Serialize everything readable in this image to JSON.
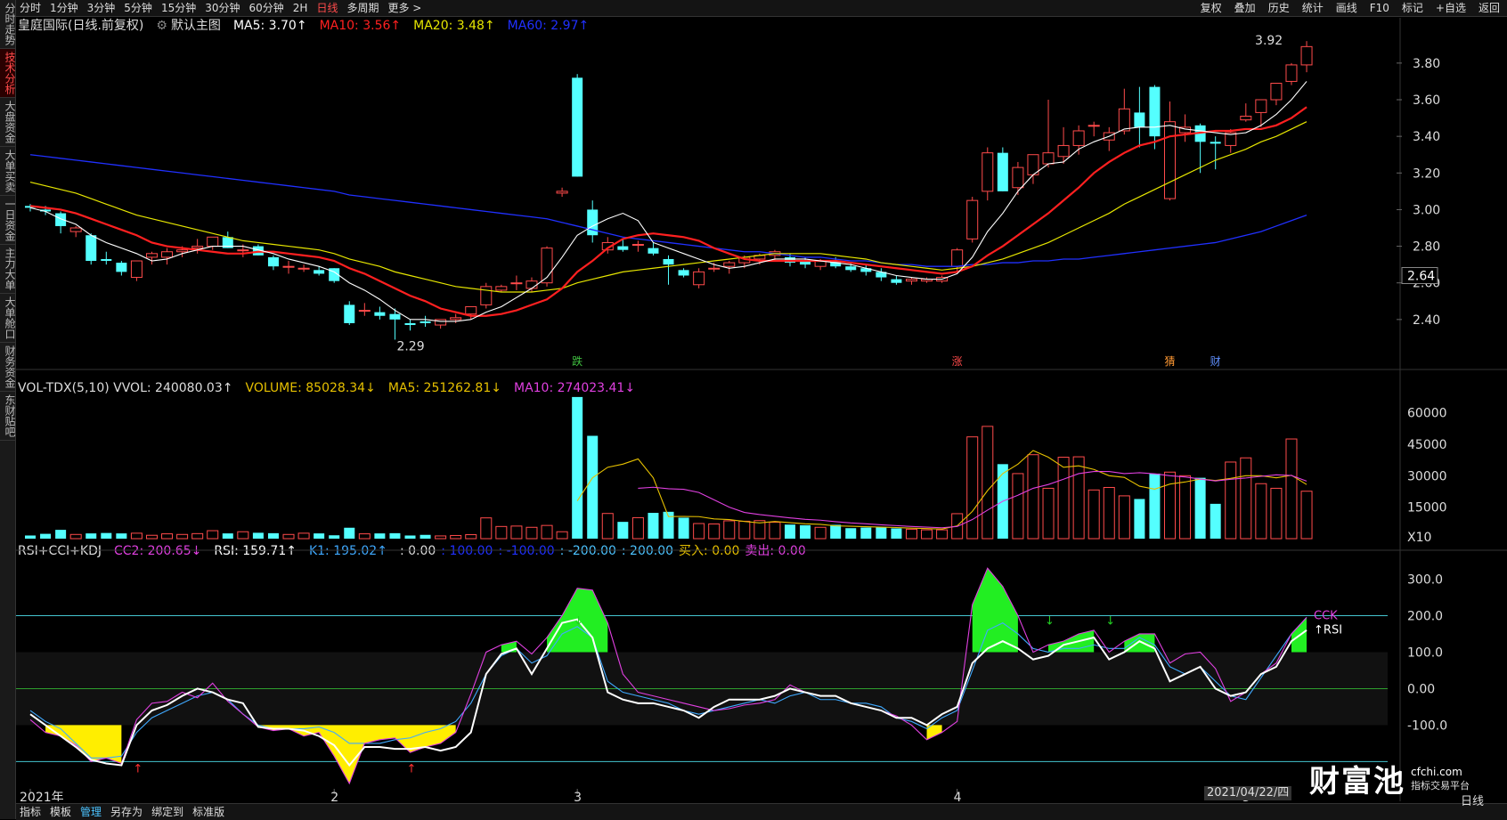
{
  "left_rail": [
    "分时走势",
    "技术分析",
    "大盘资金",
    "大单买卖",
    "一日资金",
    "主力大单",
    "大单舱口",
    "财务资金",
    "东财贴吧"
  ],
  "left_rail_active": 1,
  "period_tabs": [
    "分时",
    "1分钟",
    "3分钟",
    "5分钟",
    "15分钟",
    "30分钟",
    "60分钟",
    "2H",
    "日线",
    "多周期",
    "更多 >"
  ],
  "period_active": 8,
  "right_tools": [
    "复权",
    "叠加",
    "历史",
    "统计",
    "画线",
    "F10",
    "标记",
    "+自选",
    "返回"
  ],
  "legend_main": {
    "title": "皇庭国际(日线.前复权)",
    "default_label": "默认主图",
    "ma5": "MA5: 3.70↑",
    "ma10": "MA10: 3.56↑",
    "ma20": "MA20: 3.48↑",
    "ma60": "MA60: 2.97↑"
  },
  "legend_vol": {
    "vol": "VOL-TDX(5,10) VVOL: 240080.03↑",
    "volume": "VOLUME: 85028.34↓",
    "ma5": "MA5: 251262.81↓",
    "ma10": "MA10: 274023.41↓"
  },
  "legend_ind": {
    "name": "RSI+CCI+KDJ",
    "cc2": "CC2: 200.65↓",
    "rsi": "RSI: 159.71↑",
    "k1": "K1: 195.02↑",
    "z1": ": 0.00",
    "z2": ": 100.00",
    "z3": ": -100.00",
    "z4": ": -200.00",
    "z5": ": 200.00",
    "buy": "买入: 0.00",
    "sell": "卖出: 0.00"
  },
  "price_axis": [
    "3.80",
    "3.60",
    "3.40",
    "3.20",
    "3.00",
    "2.80",
    "2.60",
    "2.40"
  ],
  "price_current": "2.64",
  "high_label": "3.92",
  "low_label": "2.29",
  "vol_axis": [
    "60000",
    "45000",
    "30000",
    "15000",
    "X10"
  ],
  "ind_axis": [
    "300.0",
    "200.0",
    "100.0",
    "0.00",
    "-100.0"
  ],
  "ind_end_labels": [
    "CCK",
    "↑RSI"
  ],
  "date_axis": [
    "2021年",
    "2",
    "3",
    "4",
    "5"
  ],
  "date_box": "2021/04/22/四",
  "candle_marks": [
    {
      "i": 36,
      "text": "跌",
      "color": "#40c040"
    },
    {
      "i": 61,
      "text": "涨",
      "color": "#ff4b4b"
    },
    {
      "i": 75,
      "text": "猜",
      "color": "#ff9933"
    },
    {
      "i": 78,
      "text": "财",
      "color": "#6090ff"
    }
  ],
  "bottom_tabs": [
    "指标",
    "模板",
    "管理",
    "另存为",
    "绑定到",
    "标准版"
  ],
  "bottom_active": 2,
  "period_label": "日线",
  "watermark": {
    "big": "财富池",
    "site": "cfchi.com",
    "sub": "指标交易平台"
  },
  "colors": {
    "up": "#ff4b4b",
    "down": "#54ffff",
    "ma5": "#ffffff",
    "ma10": "#ff2020",
    "ma20": "#e6e600",
    "ma60": "#2030ff"
  },
  "chart_data": {
    "type": "candlestick",
    "ylim": [
      2.2,
      3.95
    ],
    "candles": [
      [
        3.02,
        3.03,
        2.99,
        3.01
      ],
      [
        3.0,
        3.02,
        2.97,
        2.99
      ],
      [
        2.98,
        2.99,
        2.87,
        2.91
      ],
      [
        2.88,
        2.91,
        2.85,
        2.9
      ],
      [
        2.86,
        2.87,
        2.7,
        2.72
      ],
      [
        2.73,
        2.77,
        2.7,
        2.72
      ],
      [
        2.71,
        2.72,
        2.64,
        2.66
      ],
      [
        2.63,
        2.72,
        2.61,
        2.72
      ],
      [
        2.74,
        2.77,
        2.7,
        2.76
      ],
      [
        2.74,
        2.79,
        2.7,
        2.77
      ],
      [
        2.77,
        2.8,
        2.74,
        2.78
      ],
      [
        2.79,
        2.84,
        2.76,
        2.8
      ],
      [
        2.8,
        2.85,
        2.78,
        2.85
      ],
      [
        2.85,
        2.88,
        2.79,
        2.79
      ],
      [
        2.78,
        2.81,
        2.74,
        2.78
      ],
      [
        2.8,
        2.81,
        2.75,
        2.75
      ],
      [
        2.74,
        2.75,
        2.67,
        2.69
      ],
      [
        2.69,
        2.72,
        2.65,
        2.69
      ],
      [
        2.68,
        2.7,
        2.66,
        2.68
      ],
      [
        2.67,
        2.69,
        2.64,
        2.65
      ],
      [
        2.68,
        2.68,
        2.6,
        2.61
      ],
      [
        2.48,
        2.5,
        2.37,
        2.38
      ],
      [
        2.45,
        2.49,
        2.42,
        2.45
      ],
      [
        2.44,
        2.47,
        2.4,
        2.42
      ],
      [
        2.43,
        2.46,
        2.29,
        2.4
      ],
      [
        2.38,
        2.4,
        2.34,
        2.37
      ],
      [
        2.39,
        2.42,
        2.36,
        2.38
      ],
      [
        2.37,
        2.4,
        2.35,
        2.4
      ],
      [
        2.4,
        2.43,
        2.38,
        2.41
      ],
      [
        2.43,
        2.47,
        2.4,
        2.47
      ],
      [
        2.48,
        2.6,
        2.46,
        2.58
      ],
      [
        2.56,
        2.59,
        2.55,
        2.58
      ],
      [
        2.6,
        2.64,
        2.56,
        2.6
      ],
      [
        2.57,
        2.63,
        2.55,
        2.61
      ],
      [
        2.6,
        2.8,
        2.58,
        2.79
      ],
      [
        3.09,
        3.12,
        3.07,
        3.1
      ],
      [
        3.72,
        3.74,
        3.18,
        3.18
      ],
      [
        3.0,
        3.05,
        2.82,
        2.86
      ],
      [
        2.78,
        2.85,
        2.76,
        2.82
      ],
      [
        2.8,
        2.84,
        2.77,
        2.78
      ],
      [
        2.81,
        2.83,
        2.77,
        2.81
      ],
      [
        2.79,
        2.82,
        2.75,
        2.76
      ],
      [
        2.73,
        2.75,
        2.59,
        2.7
      ],
      [
        2.67,
        2.68,
        2.63,
        2.64
      ],
      [
        2.59,
        2.68,
        2.57,
        2.66
      ],
      [
        2.68,
        2.71,
        2.66,
        2.68
      ],
      [
        2.69,
        2.72,
        2.65,
        2.71
      ],
      [
        2.71,
        2.75,
        2.68,
        2.74
      ],
      [
        2.73,
        2.76,
        2.7,
        2.75
      ],
      [
        2.75,
        2.78,
        2.72,
        2.77
      ],
      [
        2.74,
        2.76,
        2.69,
        2.71
      ],
      [
        2.72,
        2.74,
        2.68,
        2.7
      ],
      [
        2.69,
        2.73,
        2.67,
        2.72
      ],
      [
        2.72,
        2.74,
        2.68,
        2.69
      ],
      [
        2.69,
        2.71,
        2.66,
        2.67
      ],
      [
        2.68,
        2.7,
        2.64,
        2.66
      ],
      [
        2.66,
        2.68,
        2.61,
        2.63
      ],
      [
        2.62,
        2.64,
        2.59,
        2.6
      ],
      [
        2.61,
        2.63,
        2.59,
        2.62
      ],
      [
        2.61,
        2.63,
        2.6,
        2.62
      ],
      [
        2.61,
        2.64,
        2.6,
        2.63
      ],
      [
        2.69,
        2.79,
        2.66,
        2.78
      ],
      [
        2.84,
        3.07,
        2.82,
        3.05
      ],
      [
        3.1,
        3.34,
        3.05,
        3.31
      ],
      [
        3.31,
        3.34,
        3.1,
        3.1
      ],
      [
        3.12,
        3.26,
        3.08,
        3.23
      ],
      [
        3.19,
        3.3,
        3.14,
        3.3
      ],
      [
        3.25,
        3.6,
        3.23,
        3.31
      ],
      [
        3.29,
        3.45,
        3.25,
        3.35
      ],
      [
        3.35,
        3.46,
        3.3,
        3.43
      ],
      [
        3.46,
        3.48,
        3.4,
        3.46
      ],
      [
        3.38,
        3.45,
        3.32,
        3.42
      ],
      [
        3.43,
        3.66,
        3.41,
        3.55
      ],
      [
        3.53,
        3.67,
        3.34,
        3.45
      ],
      [
        3.67,
        3.68,
        3.33,
        3.4
      ],
      [
        3.06,
        3.59,
        3.05,
        3.48
      ],
      [
        3.42,
        3.52,
        3.37,
        3.45
      ],
      [
        3.46,
        3.47,
        3.2,
        3.37
      ],
      [
        3.37,
        3.4,
        3.22,
        3.36
      ],
      [
        3.35,
        3.44,
        3.31,
        3.42
      ],
      [
        3.49,
        3.58,
        3.48,
        3.51
      ],
      [
        3.53,
        3.6,
        3.45,
        3.6
      ],
      [
        3.6,
        3.69,
        3.57,
        3.69
      ],
      [
        3.7,
        3.8,
        3.68,
        3.79
      ],
      [
        3.79,
        3.92,
        3.75,
        3.89
      ]
    ],
    "ma5": [
      3.01,
      2.99,
      2.95,
      2.92,
      2.86,
      2.82,
      2.79,
      2.76,
      2.72,
      2.73,
      2.76,
      2.78,
      2.8,
      2.8,
      2.8,
      2.78,
      2.76,
      2.73,
      2.71,
      2.69,
      2.66,
      2.6,
      2.56,
      2.51,
      2.45,
      2.4,
      2.4,
      2.39,
      2.39,
      2.4,
      2.44,
      2.47,
      2.52,
      2.57,
      2.63,
      2.74,
      2.86,
      2.91,
      2.95,
      2.98,
      2.94,
      2.82,
      2.79,
      2.76,
      2.73,
      2.7,
      2.68,
      2.69,
      2.71,
      2.73,
      2.73,
      2.73,
      2.72,
      2.71,
      2.7,
      2.68,
      2.66,
      2.64,
      2.63,
      2.62,
      2.62,
      2.65,
      2.74,
      2.88,
      2.98,
      3.1,
      3.19,
      3.25,
      3.26,
      3.33,
      3.37,
      3.4,
      3.44,
      3.45,
      3.45,
      3.46,
      3.44,
      3.43,
      3.42,
      3.41,
      3.42,
      3.46,
      3.52,
      3.6,
      3.7
    ],
    "ma10": [
      3.02,
      3.01,
      3.0,
      2.98,
      2.95,
      2.92,
      2.89,
      2.86,
      2.82,
      2.8,
      2.79,
      2.78,
      2.77,
      2.76,
      2.76,
      2.77,
      2.77,
      2.76,
      2.75,
      2.74,
      2.72,
      2.68,
      2.65,
      2.61,
      2.57,
      2.53,
      2.5,
      2.46,
      2.44,
      2.42,
      2.42,
      2.43,
      2.45,
      2.48,
      2.51,
      2.57,
      2.66,
      2.72,
      2.79,
      2.84,
      2.86,
      2.87,
      2.86,
      2.85,
      2.83,
      2.79,
      2.76,
      2.73,
      2.72,
      2.72,
      2.72,
      2.72,
      2.72,
      2.72,
      2.71,
      2.7,
      2.69,
      2.68,
      2.67,
      2.66,
      2.65,
      2.66,
      2.69,
      2.75,
      2.8,
      2.86,
      2.92,
      2.98,
      3.05,
      3.12,
      3.2,
      3.26,
      3.31,
      3.35,
      3.37,
      3.4,
      3.41,
      3.42,
      3.43,
      3.43,
      3.44,
      3.44,
      3.46,
      3.5,
      3.56
    ],
    "ma20": [
      3.15,
      3.13,
      3.11,
      3.09,
      3.06,
      3.03,
      3.0,
      2.97,
      2.95,
      2.93,
      2.91,
      2.89,
      2.87,
      2.85,
      2.83,
      2.82,
      2.81,
      2.8,
      2.79,
      2.78,
      2.76,
      2.73,
      2.71,
      2.69,
      2.66,
      2.64,
      2.62,
      2.6,
      2.58,
      2.57,
      2.56,
      2.55,
      2.55,
      2.55,
      2.56,
      2.57,
      2.6,
      2.62,
      2.64,
      2.66,
      2.67,
      2.68,
      2.69,
      2.7,
      2.71,
      2.72,
      2.73,
      2.74,
      2.75,
      2.76,
      2.76,
      2.76,
      2.76,
      2.75,
      2.74,
      2.73,
      2.71,
      2.7,
      2.69,
      2.68,
      2.67,
      2.68,
      2.69,
      2.71,
      2.73,
      2.76,
      2.79,
      2.82,
      2.86,
      2.9,
      2.94,
      2.98,
      3.03,
      3.07,
      3.11,
      3.15,
      3.19,
      3.23,
      3.27,
      3.3,
      3.33,
      3.37,
      3.4,
      3.44,
      3.48
    ],
    "ma60": [
      3.3,
      3.29,
      3.28,
      3.27,
      3.26,
      3.25,
      3.24,
      3.23,
      3.22,
      3.21,
      3.2,
      3.19,
      3.18,
      3.17,
      3.16,
      3.15,
      3.14,
      3.13,
      3.12,
      3.11,
      3.1,
      3.08,
      3.07,
      3.06,
      3.05,
      3.04,
      3.03,
      3.02,
      3.01,
      3.0,
      2.99,
      2.98,
      2.97,
      2.96,
      2.95,
      2.93,
      2.91,
      2.89,
      2.87,
      2.85,
      2.84,
      2.83,
      2.82,
      2.81,
      2.8,
      2.79,
      2.78,
      2.77,
      2.77,
      2.76,
      2.75,
      2.74,
      2.74,
      2.73,
      2.72,
      2.72,
      2.71,
      2.7,
      2.7,
      2.69,
      2.69,
      2.69,
      2.7,
      2.7,
      2.71,
      2.71,
      2.72,
      2.72,
      2.73,
      2.73,
      2.74,
      2.75,
      2.76,
      2.77,
      2.78,
      2.79,
      2.8,
      2.81,
      2.82,
      2.84,
      2.86,
      2.88,
      2.91,
      2.94,
      2.97
    ],
    "volume": [
      1500,
      2300,
      4200,
      2000,
      2500,
      2700,
      2500,
      2600,
      1600,
      2300,
      2000,
      2400,
      3800,
      2500,
      3300,
      2800,
      2600,
      2000,
      2600,
      2500,
      1600,
      5200,
      2300,
      2500,
      2600,
      1500,
      1800,
      1300,
      1500,
      1900,
      9900,
      5800,
      6000,
      5400,
      6300,
      3300,
      67500,
      49000,
      12000,
      8000,
      10000,
      12300,
      12800,
      10000,
      7200,
      7000,
      8500,
      8300,
      8600,
      7800,
      6700,
      6400,
      5400,
      6600,
      5000,
      5300,
      5300,
      4900,
      4500,
      4200,
      4200,
      11900,
      48500,
      53500,
      35500,
      31000,
      40000,
      24000,
      38800,
      39000,
      23200,
      24400,
      20400,
      18900,
      31000,
      31700,
      30000,
      29000,
      16600,
      36500,
      38500,
      26200,
      24000,
      47500,
      22600
    ],
    "vol_ma5": [
      null,
      null,
      null,
      null,
      null,
      null,
      null,
      null,
      null,
      null,
      null,
      null,
      null,
      null,
      null,
      null,
      null,
      null,
      null,
      null,
      null,
      null,
      null,
      null,
      null,
      null,
      null,
      null,
      null,
      null,
      null,
      null,
      null,
      null,
      null,
      null,
      18000,
      29000,
      34000,
      35500,
      38000,
      29000,
      10500,
      10600,
      10500,
      9400,
      9100,
      8200,
      7500,
      8200,
      7600,
      7100,
      6800,
      6100,
      5900,
      5700,
      5500,
      5300,
      5000,
      4800,
      4600,
      6100,
      13000,
      22900,
      31000,
      35500,
      42000,
      38800,
      34000,
      34700,
      33000,
      30000,
      29200,
      25000,
      23600,
      26000,
      27000,
      28400,
      27700,
      28700,
      30000,
      30000,
      29000,
      30200,
      25800
    ],
    "vol_ma10": [
      null,
      null,
      null,
      null,
      null,
      null,
      null,
      null,
      null,
      null,
      null,
      null,
      null,
      null,
      null,
      null,
      null,
      null,
      null,
      null,
      null,
      null,
      null,
      null,
      null,
      null,
      null,
      null,
      null,
      null,
      null,
      null,
      null,
      null,
      null,
      null,
      null,
      null,
      null,
      null,
      24000,
      24500,
      23800,
      23500,
      22000,
      18500,
      15000,
      12500,
      11500,
      10700,
      9900,
      9200,
      8800,
      8100,
      7500,
      7100,
      6600,
      6200,
      5800,
      5500,
      5200,
      5800,
      9100,
      13600,
      17800,
      20700,
      24000,
      25800,
      28300,
      31000,
      32000,
      32000,
      31000,
      31400,
      30900,
      30000,
      29400,
      28400,
      27500,
      28300,
      28900,
      29700,
      30400,
      30100,
      27400
    ],
    "cci": [
      -85,
      -120,
      -130,
      -155,
      -200,
      -190,
      -205,
      -85,
      -40,
      -35,
      -10,
      -25,
      15,
      -35,
      -70,
      -105,
      -115,
      -110,
      -130,
      -120,
      -185,
      -260,
      -150,
      -140,
      -135,
      -175,
      -160,
      -150,
      -120,
      -15,
      100,
      120,
      130,
      95,
      140,
      200,
      275,
      270,
      180,
      40,
      -10,
      -20,
      -30,
      -40,
      -50,
      -60,
      -55,
      -45,
      -40,
      -30,
      10,
      -10,
      -20,
      -20,
      -40,
      -50,
      -60,
      -75,
      -100,
      -140,
      -120,
      -90,
      230,
      330,
      280,
      200,
      100,
      120,
      130,
      150,
      160,
      100,
      130,
      150,
      150,
      70,
      95,
      100,
      55,
      -35,
      -10,
      40,
      70,
      150,
      195
    ],
    "rsi": [
      -70,
      -100,
      -130,
      -160,
      -195,
      -205,
      -210,
      -100,
      -60,
      -45,
      -20,
      0,
      -10,
      -30,
      -40,
      -105,
      -110,
      -110,
      -115,
      -130,
      -155,
      -210,
      -160,
      -160,
      -165,
      -165,
      -160,
      -170,
      -160,
      -120,
      40,
      95,
      110,
      40,
      110,
      180,
      190,
      140,
      -10,
      -30,
      -40,
      -40,
      -50,
      -60,
      -80,
      -50,
      -30,
      -30,
      -30,
      -20,
      0,
      -10,
      -20,
      -20,
      -40,
      -50,
      -60,
      -80,
      -80,
      -100,
      -70,
      -50,
      70,
      110,
      130,
      110,
      80,
      90,
      120,
      130,
      140,
      80,
      100,
      130,
      110,
      20,
      40,
      60,
      0,
      -20,
      -10,
      40,
      60,
      130,
      160
    ],
    "k1": [
      -60,
      -90,
      -110,
      -150,
      -190,
      -190,
      -185,
      -120,
      -80,
      -60,
      -40,
      -20,
      -10,
      -30,
      -70,
      -100,
      -110,
      -110,
      -110,
      -105,
      -120,
      -150,
      -150,
      -150,
      -140,
      -135,
      -120,
      -110,
      -90,
      -40,
      40,
      90,
      110,
      70,
      90,
      150,
      170,
      140,
      20,
      -10,
      -20,
      -30,
      -40,
      -60,
      -70,
      -60,
      -50,
      -40,
      -30,
      -40,
      -20,
      -10,
      -30,
      -30,
      -40,
      -40,
      -50,
      -80,
      -90,
      -110,
      -80,
      -60,
      50,
      160,
      180,
      150,
      110,
      100,
      110,
      110,
      120,
      110,
      110,
      140,
      120,
      60,
      40,
      60,
      20,
      -20,
      -30,
      30,
      90,
      150,
      195
    ]
  }
}
